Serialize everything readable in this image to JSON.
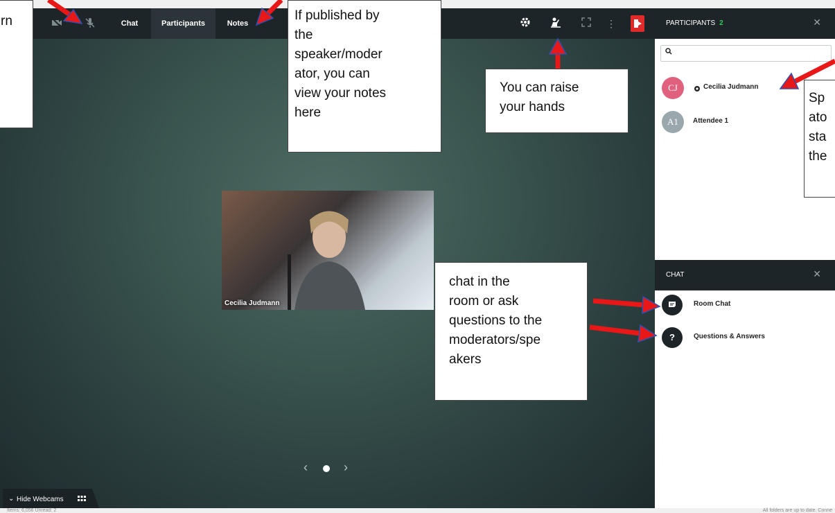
{
  "toolbar": {
    "tabs": [
      "Chat",
      "Participants",
      "Notes"
    ],
    "icons": [
      "camera-off-icon",
      "mic-off-icon",
      "gear-icon",
      "raise-hand-icon",
      "fullscreen-icon",
      "more-icon",
      "exit-icon"
    ]
  },
  "video": {
    "name": "Cecilia Judmann"
  },
  "participants_panel": {
    "title": "PARTICIPANTS",
    "count": "2",
    "close": "✕",
    "items": [
      {
        "initials": "CJ",
        "name": "Cecilia Judmann",
        "color": "#e0607e"
      },
      {
        "initials": "A1",
        "name": "Attendee 1",
        "color": "#9aa7ad"
      }
    ]
  },
  "chat_panel": {
    "title": "CHAT",
    "close": "✕",
    "items": [
      {
        "label": "Room Chat",
        "icon": "chat-icon"
      },
      {
        "label": "Questions & Answers",
        "icon": "question-icon",
        "glyph": "?"
      }
    ]
  },
  "bottom": {
    "hide_webcams": "Hide Webcams"
  },
  "status": {
    "left": "Items: 6,056    Unread: 2",
    "right": "All folders are up to date.   Conne"
  },
  "callouts": {
    "left_fragment": "rn",
    "notes": [
      "If published by",
      "the",
      "speaker/moder",
      "ator, you can",
      "view your notes",
      "here"
    ],
    "hands": [
      "You can raise",
      "your hands"
    ],
    "chat": [
      "chat in the",
      "room or ask",
      "questions to the",
      "moderators/spe",
      "akers"
    ],
    "right_fragment": [
      "Sp",
      "ato",
      "sta",
      "the"
    ]
  },
  "colors": {
    "accent_green": "#36c95b",
    "exit_red": "#e02b2b",
    "annotation_red": "#e81818"
  }
}
